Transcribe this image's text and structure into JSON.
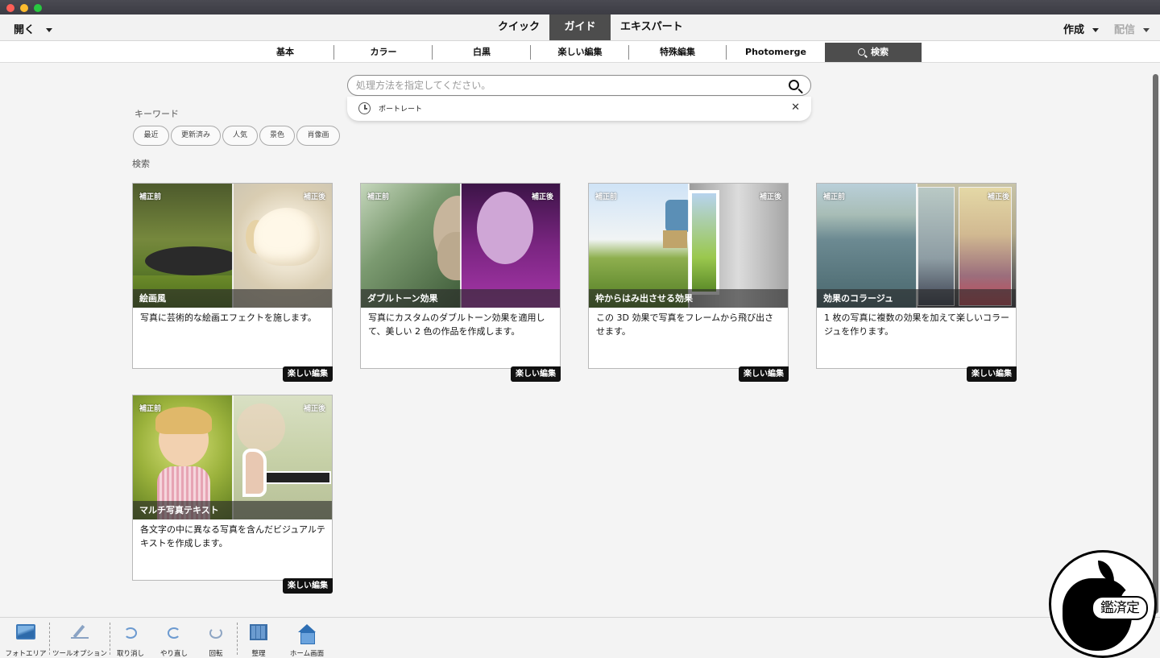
{
  "window": {
    "traffic_lights": [
      "close",
      "minimize",
      "zoom"
    ]
  },
  "modebar": {
    "open_label": "開く",
    "modes": [
      "クイック",
      "ガイド",
      "エキスパート"
    ],
    "active_mode": "ガイド",
    "create_label": "作成",
    "share_label": "配信"
  },
  "categories": {
    "tabs": [
      "基本",
      "カラー",
      "白黒",
      "楽しい編集",
      "特殊編集",
      "Photomerge",
      "検索"
    ],
    "active": "検索"
  },
  "search": {
    "placeholder": "処理方法を指定してください。",
    "value": "",
    "suggestion": "ポートレート"
  },
  "keywords": {
    "label": "キーワード",
    "chips": [
      "最近",
      "更新済み",
      "人気",
      "景色",
      "肖像画"
    ]
  },
  "results_label": "検索",
  "cards": [
    {
      "before": "補正前",
      "after": "補正後",
      "title": "絵画風",
      "description": "写真に芸術的な絵画エフェクトを施します。",
      "badge": "楽しい編集"
    },
    {
      "before": "補正前",
      "after": "補正後",
      "title": "ダブルトーン効果",
      "description": "写真にカスタムのダブルトーン効果を適用して、美しい 2 色の作品を作成します。",
      "badge": "楽しい編集"
    },
    {
      "before": "補正前",
      "after": "補正後",
      "title": "枠からはみ出させる効果",
      "description": "この 3D 効果で写真をフレームから飛び出させます。",
      "badge": "楽しい編集"
    },
    {
      "before": "補正前",
      "after": "補正後",
      "title": "効果のコラージュ",
      "description": "1 枚の写真に複数の効果を加えて楽しいコラージュを作ります。",
      "badge": "楽しい編集"
    },
    {
      "before": "補正前",
      "after": "補正後",
      "title": "マルチ写真テキスト",
      "description": "各文字の中に異なる写真を含んだビジュアルテキストを作成します。",
      "badge": "楽しい編集"
    }
  ],
  "toolbar": {
    "photo_area": "フォトエリア",
    "tool_options": "ツールオプション",
    "undo": "取り消し",
    "redo": "やり直し",
    "rotate": "回転",
    "organize": "整理",
    "home": "ホーム画面"
  },
  "seal": {
    "text": "鑑済定"
  }
}
